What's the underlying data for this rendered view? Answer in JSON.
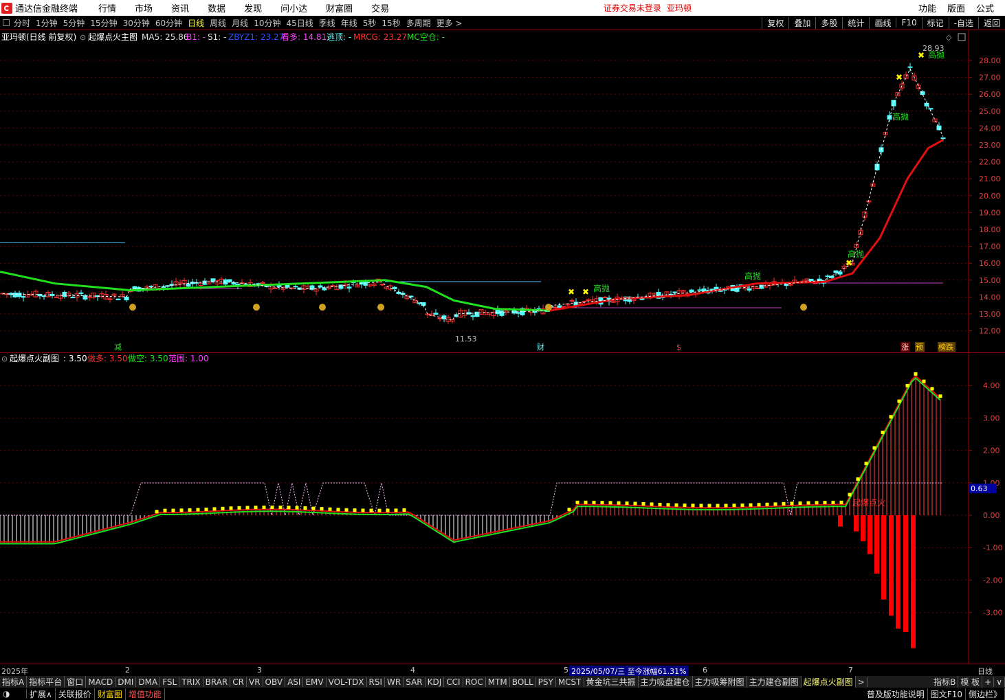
{
  "menubar": {
    "title": "通达信金融终端",
    "items": [
      "行情",
      "市场",
      "资讯",
      "数据",
      "发现",
      "问小达",
      "财富圈",
      "交易"
    ],
    "warning": "证券交易未登录",
    "stock": "亚玛顿",
    "right": [
      "功能",
      "版面",
      "公式"
    ]
  },
  "periodbar": {
    "periods": [
      "分时",
      "1分钟",
      "5分钟",
      "15分钟",
      "30分钟",
      "60分钟",
      "日线",
      "周线",
      "月线",
      "10分钟",
      "45日线",
      "季线",
      "年线",
      "5秒",
      "15秒",
      "多周期",
      "更多 >"
    ],
    "selected": "日线",
    "tools": [
      "复权",
      "叠加",
      "多股",
      "统计",
      "画线",
      "F10",
      "标记",
      "-自选",
      "返回"
    ]
  },
  "main_header": {
    "name": "亚玛顿(日线 前复权)",
    "indicator": "起爆点火主图",
    "ma5_label": "MA5: 25.86",
    "b1": "B1: -",
    "s1": "S1: -",
    "zbyz": "ZBYZ1: 23.27",
    "kanduo": "看多: 14.81",
    "taoding": "逃顶: -",
    "mrcg": "MRCG: 23.27",
    "mckong": "MC空仓: -"
  },
  "sub_header": {
    "name": "起爆点火副图",
    "value": ": 3.50",
    "zuoduo": "做多: 3.50",
    "zuokong": "做空: 3.50",
    "fanwei": "范围: 1.00"
  },
  "price_axis": [
    "28.00",
    "27.00",
    "26.00",
    "25.00",
    "24.00",
    "23.00",
    "22.00",
    "21.00",
    "20.00",
    "19.00",
    "18.00",
    "17.00",
    "16.00",
    "15.00",
    "14.00",
    "13.00",
    "12.00"
  ],
  "sub_axis": [
    "4.00",
    "3.00",
    "2.00",
    "1.00",
    "0.00",
    "-1.00",
    "-2.00",
    "-3.00"
  ],
  "sub_axis_marker": "0.63",
  "annotations": {
    "high": "28.93",
    "low": "11.53",
    "gaopao": "高抛",
    "bottom_tags": [
      "减",
      "财",
      "$",
      "涨",
      "预",
      "榜跌"
    ],
    "qibao": "起爆点火"
  },
  "datebar": {
    "labels": [
      "2025年",
      "2",
      "3",
      "4",
      "5",
      "6",
      "7"
    ],
    "highlight": "2025/05/07/三  至今涨幅61.31%",
    "right": "日线"
  },
  "tabbar": {
    "tabs": [
      "指标A",
      "指标平台",
      "窗口",
      "MACD",
      "DMI",
      "DMA",
      "FSL",
      "TRIX",
      "BRAR",
      "CR",
      "VR",
      "OBV",
      "ASI",
      "EMV",
      "VOL-TDX",
      "RSI",
      "WR",
      "SAR",
      "KDJ",
      "CCI",
      "ROC",
      "MTM",
      "BOLL",
      "PSY",
      "MCST",
      "黄金坑三共振",
      "主力吸盘建仓",
      "主力吸筹附图",
      "主力建仓副图",
      "起爆点火副图",
      ">"
    ],
    "selected": "起爆点火副图",
    "right": [
      "指标B",
      "模 板",
      "+",
      "∨"
    ]
  },
  "statusbar": {
    "items": [
      "扩展∧",
      "关联报价",
      "财富圈",
      "增值功能"
    ],
    "right": [
      "普及版功能说明",
      "图文F10",
      "侧边栏》"
    ]
  },
  "colors": {
    "up": "#ff3030",
    "down": "#54ffff",
    "green": "#20e020",
    "red": "#e01010",
    "yellow": "#ffff00",
    "purple": "#ff40ff",
    "axis": "#a00000"
  }
}
